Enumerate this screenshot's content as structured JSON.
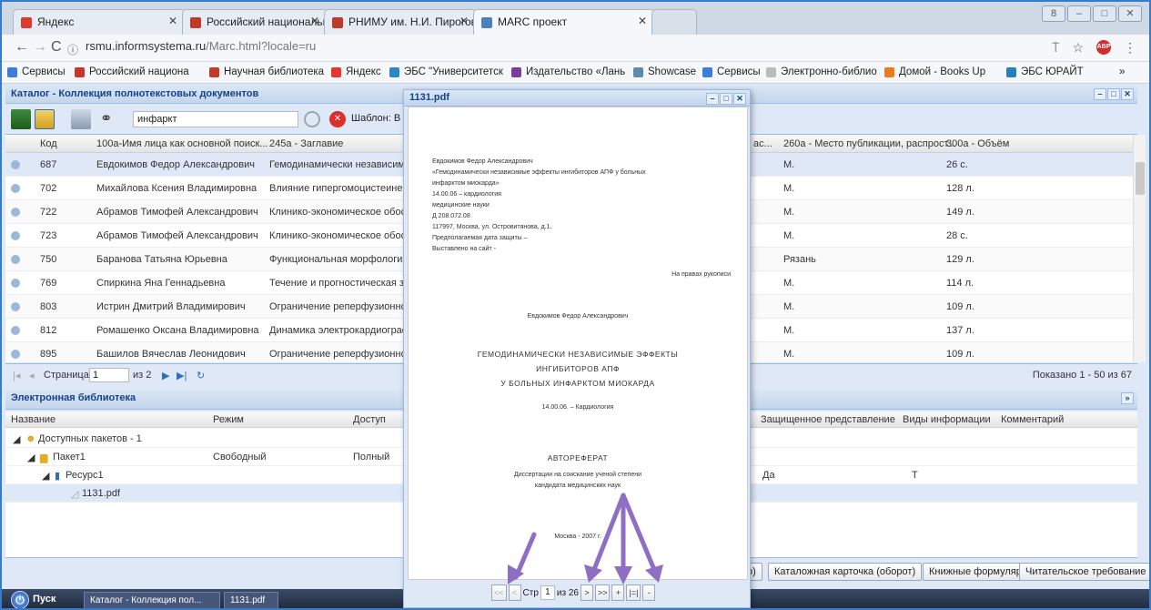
{
  "browser": {
    "tabs": [
      {
        "label": "Яндекс",
        "color": "#e03a2f"
      },
      {
        "label": "Российский национальный",
        "color": "#c0392b"
      },
      {
        "label": "РНИМУ им. Н.И. Пирогова",
        "color": "#c0392b"
      },
      {
        "label": "MARC проект",
        "color": "#4a7fc1"
      }
    ],
    "url_host": "rsmu.informsystema.ru",
    "url_path": "/Marc.html?locale=ru",
    "bookmarks": [
      "Сервисы",
      "Российский национа",
      "Научная библиотека",
      "Яндекс",
      "ЭБС \"Университетск",
      "Издательство «Лань",
      "Showcase",
      "Сервисы",
      "Электронно-библио",
      "Домой - Books Up",
      "ЭБС ЮРАЙТ"
    ]
  },
  "catalog": {
    "title": "Каталог - Коллекция полнотекстовых документов",
    "search_value": "инфаркт",
    "template_label": "Шаблон: В",
    "columns": [
      "Код",
      "100a-Имя лица как основной поиск...",
      "245a - Заглавие",
      "ас...",
      "260a - Место публикации, распрост...",
      "300a - Объём"
    ],
    "rows": [
      {
        "code": "687",
        "name": "Евдокимов Федор Александрович",
        "title": "Гемодинамически независимы",
        "place": "М.",
        "volume": "26 с."
      },
      {
        "code": "702",
        "name": "Михайлова Ксения Владимировна",
        "title": "Влияние гипергомоцистеинемі",
        "place": "М.",
        "volume": "128 л."
      },
      {
        "code": "722",
        "name": "Абрамов Тимофей Александрович",
        "title": "Клинико-экономическое обосн",
        "place": "М.",
        "volume": "149 л."
      },
      {
        "code": "723",
        "name": "Абрамов Тимофей Александрович",
        "title": "Клинико-экономическое обосн",
        "place": "М.",
        "volume": "28 с."
      },
      {
        "code": "750",
        "name": "Баранова Татьяна Юрьевна",
        "title": "Функциональная морфология с",
        "place": "Рязань",
        "volume": "129 л."
      },
      {
        "code": "769",
        "name": "Спиркина Яна Геннадьевна",
        "title": "Течение и прогностическая зн",
        "place": "М.",
        "volume": "114 л."
      },
      {
        "code": "803",
        "name": "Истрин Дмитрий Владимирович",
        "title": "Ограничение реперфузионног",
        "place": "М.",
        "volume": "109 л."
      },
      {
        "code": "812",
        "name": "Ромашенко Оксана Владимировна",
        "title": "Динамика электрокардиографі",
        "place": "М.",
        "volume": "137 л."
      },
      {
        "code": "895",
        "name": "Башилов Вячеслав Леонидович",
        "title": "Ограничение реперфузионног",
        "place": "М.",
        "volume": "109 л."
      }
    ],
    "pager": {
      "page_label": "Страница",
      "page_value": "1",
      "of_label": "из 2",
      "shown": "Показано 1 - 50 из 67"
    }
  },
  "library": {
    "title": "Электронная библиотека",
    "columns": [
      "Название",
      "Режим",
      "Доступ",
      "Защищенное представление",
      "Виды информации",
      "Комментарий"
    ],
    "rows": [
      {
        "name": "Доступных пакетов - 1",
        "mode": "",
        "access": "",
        "protected": "",
        "info": ""
      },
      {
        "name": "Пакет1",
        "mode": "Свободный",
        "access": "Полный",
        "protected": "",
        "info": ""
      },
      {
        "name": "Ресурс1",
        "mode": "",
        "access": "",
        "protected": "Да",
        "info": "Т"
      },
      {
        "name": "1131.pdf",
        "mode": "",
        "access": "",
        "protected": "",
        "info": ""
      }
    ],
    "buttons": [
      "р)",
      "Каталожная карточка (оборот)",
      "Книжные формуляры",
      "Читательское требование"
    ]
  },
  "pdf": {
    "title": "1131.pdf",
    "left_lines": [
      "Евдокимов Федор Александрович",
      "«Гемодинамически независимые эффекты ингибиторов АПФ у больных",
      "инфарктом миокарда»",
      "14.00.06 – кардиология",
      "медицинские науки",
      "Д 208.072.08",
      "117997, Москва, ул. Островитянова, д.1.",
      "Предполагаемая дата защиты –",
      "Выставлено на сайт -"
    ],
    "rights": "На правах рукописи",
    "author": "Евдокимов Федор Александрович",
    "heading": [
      "ГЕМОДИНАМИЧЕСКИ НЕЗАВИСИМЫЕ ЭФФЕКТЫ",
      "ИНГИБИТОРОВ АПФ",
      "У БОЛЬНЫХ ИНФАРКТОМ МИОКАРДА"
    ],
    "specialty": "14.00.06. – Кардиология",
    "abstract": "АВТОРЕФЕРАТ",
    "degree": [
      "Диссертации  на соискание ученой степени",
      "кандидата медицинских наук"
    ],
    "city_year": "Москва - 2007 г.",
    "nav": {
      "page_label": "Стр",
      "page_value": "1",
      "of_label": "из 26",
      "next": ">",
      "last": ">>",
      "zoom_in": "+",
      "fit": "|=|",
      "zoom_out": "-",
      "prev": "<",
      "first": "<<"
    }
  },
  "taskbar": {
    "start": "Пуск",
    "tasks": [
      "Каталог - Коллекция пол...",
      "1131.pdf"
    ]
  }
}
